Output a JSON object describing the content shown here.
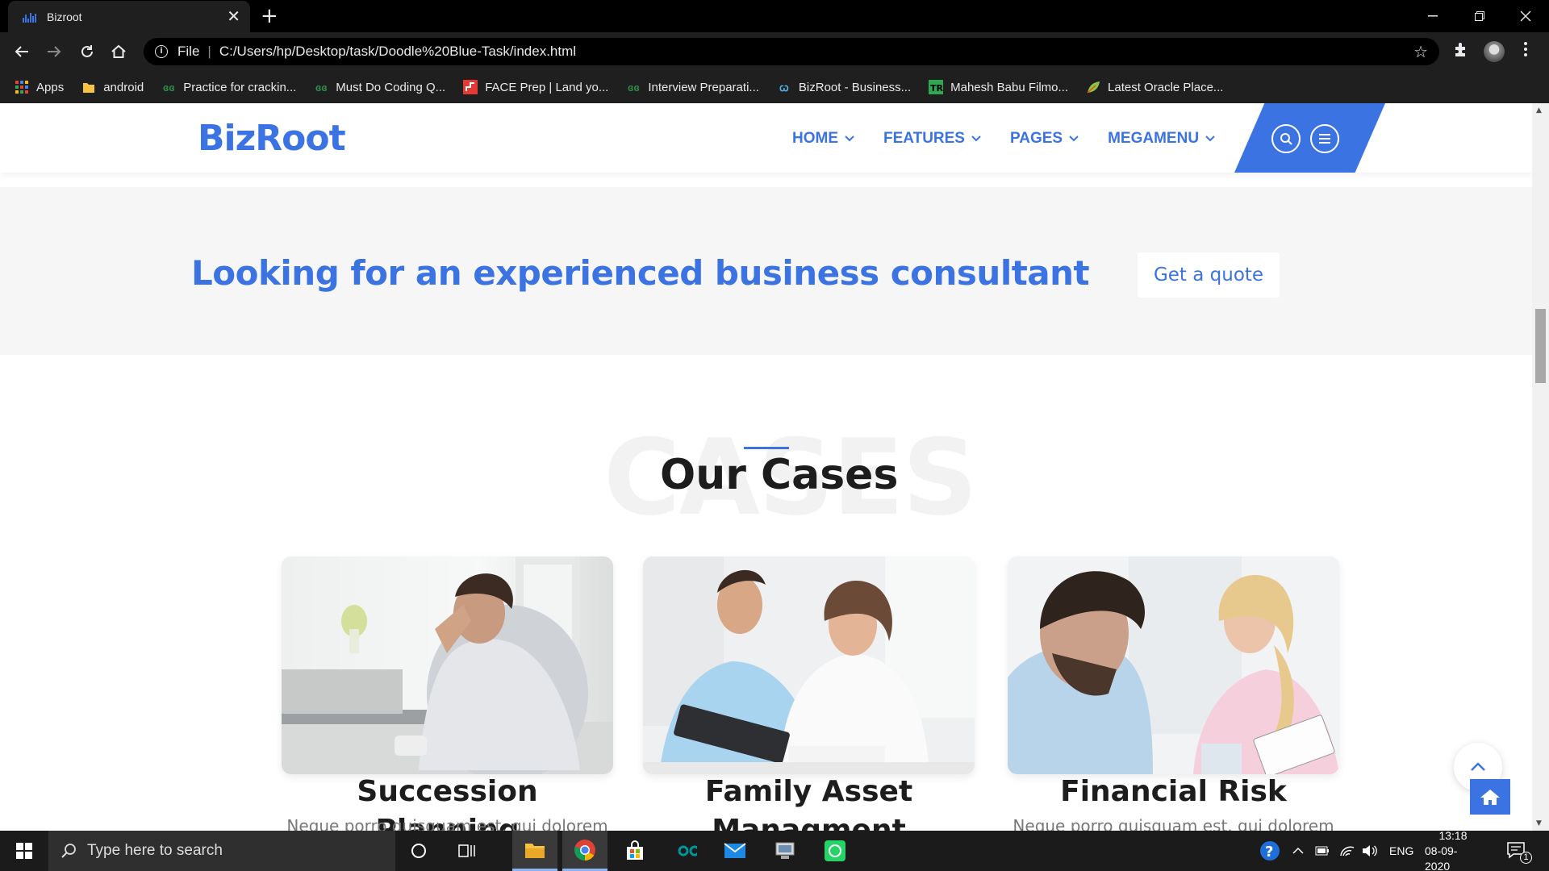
{
  "browser": {
    "tab_title": "Bizroot",
    "tab_close": "✕",
    "new_tab": "+",
    "address_scheme": "File",
    "address_url": "C:/Users/hp/Desktop/task/Doodle%20Blue-Task/index.html",
    "bookmarks": [
      {
        "label": "Apps",
        "icon": "apps-grid-icon"
      },
      {
        "label": "android",
        "icon": "folder-icon"
      },
      {
        "label": "Practice for crackin...",
        "icon": "gfg-icon"
      },
      {
        "label": "Must Do Coding Q...",
        "icon": "gfg-icon"
      },
      {
        "label": "FACE Prep | Land yo...",
        "icon": "faceprep-icon"
      },
      {
        "label": "Interview Preparati...",
        "icon": "gfg-icon"
      },
      {
        "label": "BizRoot - Business...",
        "icon": "bizroot-icon"
      },
      {
        "label": "Mahesh Babu Filmo...",
        "icon": "tr-icon"
      },
      {
        "label": "Latest Oracle Place...",
        "icon": "leaf-icon"
      }
    ]
  },
  "site": {
    "logo": "BizRoot",
    "nav": [
      {
        "label": "HOME"
      },
      {
        "label": "FEATURES"
      },
      {
        "label": "PAGES"
      },
      {
        "label": "MEGAMENU"
      }
    ],
    "cta": {
      "headline": "Looking for an experienced business consultant",
      "button": "Get a quote"
    },
    "cases": {
      "bg_text": "CASES",
      "title": "Our Cases",
      "items": [
        {
          "title": "Succession Planning",
          "desc": "Neque porro quisquam est, qui dolorem"
        },
        {
          "title": "Family Asset Managment",
          "desc": ""
        },
        {
          "title": "Financial Risk",
          "desc": "Neque porro quisquam est, qui dolorem"
        }
      ]
    }
  },
  "taskbar": {
    "search_placeholder": "Type here to search",
    "language": "ENG",
    "time": "13:18",
    "date": "08-09-2020",
    "notification_count": "1"
  },
  "colors": {
    "brand_blue": "#3b73e2",
    "cta_bg": "#f6f6f6",
    "chrome_dark": "#1f1f1f"
  }
}
